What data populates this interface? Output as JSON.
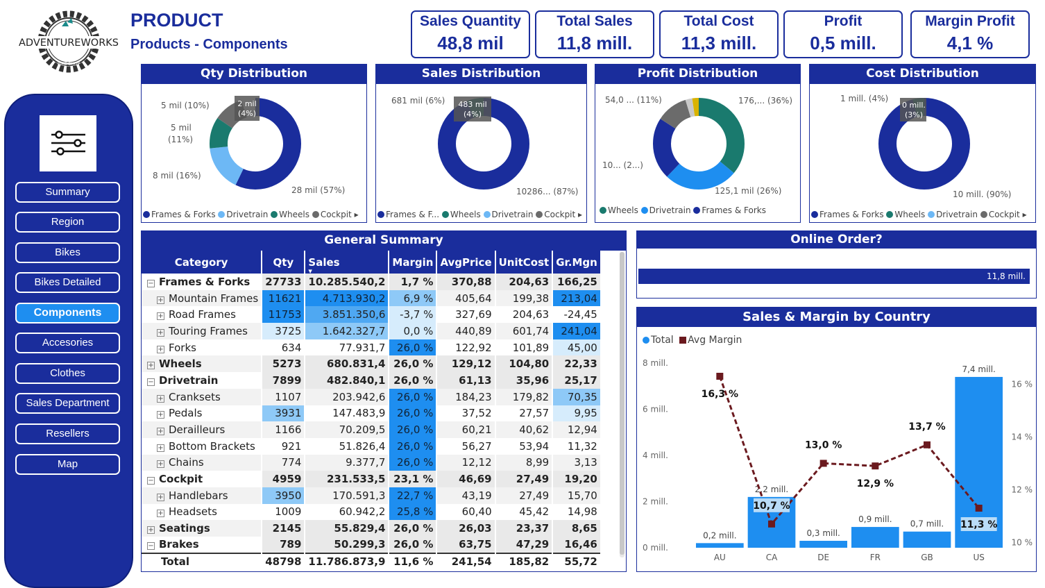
{
  "header": {
    "logo_text": "ADVENTUREWORKS",
    "logo_small": "BIKE SHOP",
    "title": "PRODUCT",
    "subtitle": "Products - Components"
  },
  "kpis": [
    {
      "label": "Sales Quantity",
      "value": "48,8 mil"
    },
    {
      "label": "Total Sales",
      "value": "11,8 mill."
    },
    {
      "label": "Total Cost",
      "value": "11,3 mill."
    },
    {
      "label": "Profit",
      "value": "0,5 mill."
    },
    {
      "label": "Margin Profit",
      "value": "4,1 %"
    }
  ],
  "nav": {
    "filter_icon": "sliders-icon",
    "items": [
      "Summary",
      "Region",
      "Bikes",
      "Bikes Detailed",
      "Components",
      "Accesories",
      "Clothes",
      "Sales Department",
      "Resellers",
      "Map"
    ],
    "active": "Components"
  },
  "colors": {
    "navy": "#1a2d9c",
    "blue": "#1e8ef0",
    "teal": "#1a7a6e",
    "lightblue": "#6db8f5",
    "grey": "#6b6b6b",
    "maroon": "#6b1a1f",
    "gold": "#d9b300",
    "silver": "#c8c8c8"
  },
  "donuts": [
    {
      "title": "Qty Distribution",
      "labels": [
        "5 mil (10%)",
        "2 mil (4%)",
        "5 mil (11%)",
        "8 mil (16%)",
        "28 mil (57%)"
      ],
      "legend": [
        "Frames & Forks",
        "Drivetrain",
        "Wheels",
        "Cockpit"
      ]
    },
    {
      "title": "Sales Distribution",
      "labels": [
        "681 mil (6%)",
        "483 mil (4%)",
        "10286... (87%)"
      ],
      "legend": [
        "Frames & F...",
        "Wheels",
        "Drivetrain",
        "Cockpit"
      ]
    },
    {
      "title": "Profit Distribution",
      "labels": [
        "54,0 ... (11%)",
        "176,... (36%)",
        "10... (2...)",
        "125,1 mil (26%)"
      ],
      "legend": [
        "Wheels",
        "Drivetrain",
        "Frames & Forks"
      ]
    },
    {
      "title": "Cost Distribution",
      "labels": [
        "1 mill. (4%)",
        "0 mill. (3%)",
        "10 mill. (90%)"
      ],
      "legend": [
        "Frames & Forks",
        "Wheels",
        "Drivetrain",
        "Cockpit"
      ]
    }
  ],
  "summary": {
    "title": "General Summary",
    "columns": [
      "Category",
      "Qty",
      "Sales",
      "Margin",
      "AvgPrice",
      "UnitCost",
      "Gr.Mgn"
    ],
    "rows": [
      {
        "level": 0,
        "sign": "−",
        "cells": [
          "Frames & Forks",
          "27733",
          "10.285.540,2",
          "1,7 %",
          "370,88",
          "204,63",
          "166,25"
        ]
      },
      {
        "level": 1,
        "cells": [
          "Mountain Frames",
          "11621",
          "4.713.930,2",
          "6,9 %",
          "405,64",
          "199,38",
          "213,04"
        ]
      },
      {
        "level": 1,
        "cells": [
          "Road Frames",
          "11753",
          "3.851.350,6",
          "-3,7 %",
          "327,69",
          "204,63",
          "-24,45"
        ]
      },
      {
        "level": 1,
        "cells": [
          "Touring Frames",
          "3725",
          "1.642.327,7",
          "0,0 %",
          "440,89",
          "601,74",
          "241,04"
        ]
      },
      {
        "level": 1,
        "cells": [
          "Forks",
          "634",
          "77.931,7",
          "26,0 %",
          "122,92",
          "101,89",
          "45,00"
        ]
      },
      {
        "level": 0,
        "sign": "+",
        "cells": [
          "Wheels",
          "5273",
          "680.831,4",
          "26,0 %",
          "129,12",
          "104,80",
          "22,33"
        ]
      },
      {
        "level": 0,
        "sign": "−",
        "cells": [
          "Drivetrain",
          "7899",
          "482.840,1",
          "26,0 %",
          "61,13",
          "35,96",
          "25,17"
        ]
      },
      {
        "level": 1,
        "cells": [
          "Cranksets",
          "1107",
          "203.942,6",
          "26,0 %",
          "184,23",
          "179,82",
          "70,35"
        ]
      },
      {
        "level": 1,
        "cells": [
          "Pedals",
          "3931",
          "147.483,9",
          "26,0 %",
          "37,52",
          "27,57",
          "9,95"
        ]
      },
      {
        "level": 1,
        "cells": [
          "Derailleurs",
          "1166",
          "70.209,5",
          "26,0 %",
          "60,21",
          "40,62",
          "12,94"
        ]
      },
      {
        "level": 1,
        "cells": [
          "Bottom Brackets",
          "921",
          "51.826,4",
          "26,0 %",
          "56,27",
          "53,94",
          "11,32"
        ]
      },
      {
        "level": 1,
        "cells": [
          "Chains",
          "774",
          "9.377,7",
          "26,0 %",
          "12,12",
          "8,99",
          "3,13"
        ]
      },
      {
        "level": 0,
        "sign": "−",
        "cells": [
          "Cockpit",
          "4959",
          "231.533,5",
          "23,1 %",
          "46,69",
          "27,49",
          "19,20"
        ]
      },
      {
        "level": 1,
        "cells": [
          "Handlebars",
          "3950",
          "170.591,3",
          "22,7 %",
          "43,19",
          "27,49",
          "15,70"
        ]
      },
      {
        "level": 1,
        "cells": [
          "Headsets",
          "1009",
          "60.942,2",
          "25,8 %",
          "60,40",
          "45,42",
          "14,98"
        ]
      },
      {
        "level": 0,
        "sign": "+",
        "cells": [
          "Seatings",
          "2145",
          "55.829,4",
          "26,0 %",
          "26,03",
          "23,37",
          "8,65"
        ]
      },
      {
        "level": 0,
        "sign": "−",
        "cells": [
          "Brakes",
          "789",
          "50.299,3",
          "26,0 %",
          "63,75",
          "47,29",
          "16,46"
        ]
      }
    ],
    "total": [
      "Total",
      "48798",
      "11.786.873,9",
      "11,6 %",
      "241,54",
      "185,82",
      "55,72"
    ]
  },
  "online_order": {
    "title": "Online Order?",
    "value_label": "11,8 mill.",
    "fill_fraction": 0.99
  },
  "country_chart": {
    "title": "Sales & Margin by Country",
    "legend": [
      "Total",
      "Avg Margin"
    ],
    "y_ticks": [
      "0 mill.",
      "2 mill.",
      "4 mill.",
      "6 mill.",
      "8 mill."
    ],
    "y2_ticks": [
      "10 %",
      "12 %",
      "14 %",
      "16 %"
    ]
  },
  "chart_data": {
    "type": "bar",
    "categories": [
      "AU",
      "CA",
      "DE",
      "FR",
      "GB",
      "US"
    ],
    "series": [
      {
        "name": "Total",
        "values": [
          0.2,
          2.2,
          0.3,
          0.9,
          0.7,
          7.4
        ],
        "labels": [
          "0,2 mill.",
          "2,2 mill.",
          "0,3 mill.",
          "0,9 mill.",
          "0,7 mill.",
          "7,4 mill."
        ]
      },
      {
        "name": "Avg Margin",
        "type": "line",
        "values": [
          16.3,
          10.7,
          13.0,
          12.9,
          13.7,
          11.3
        ],
        "labels": [
          "16,3 %",
          "10,7 %",
          "13,0 %",
          "12,9 %",
          "13,7 %",
          "11,3 %"
        ]
      }
    ],
    "ylim": [
      0,
      8
    ],
    "y2lim": [
      9.8,
      16.8
    ]
  }
}
